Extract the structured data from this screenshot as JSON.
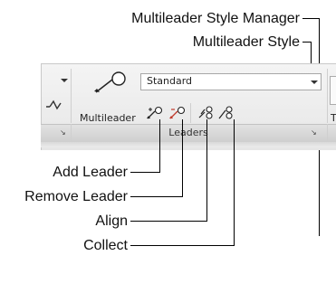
{
  "callouts": {
    "style_manager": "Multileader Style Manager",
    "style": "Multileader Style",
    "add_leader": "Add Leader",
    "remove_leader": "Remove Leader",
    "align": "Align",
    "collect": "Collect"
  },
  "ribbon": {
    "multileader_label": "Multileader",
    "style_dropdown_value": "Standard",
    "panel_title": "Leaders",
    "partial_right_label": "T"
  },
  "icons": {
    "multileader": "multileader-icon",
    "add_leader": "add-leader-icon",
    "remove_leader": "remove-leader-icon",
    "align": "align-icon",
    "collect": "collect-icon",
    "panel_launcher": "panel-launcher-icon"
  },
  "colors": {
    "ribbon_bg": "#eaeaea",
    "remove_accent": "#c0392b"
  }
}
